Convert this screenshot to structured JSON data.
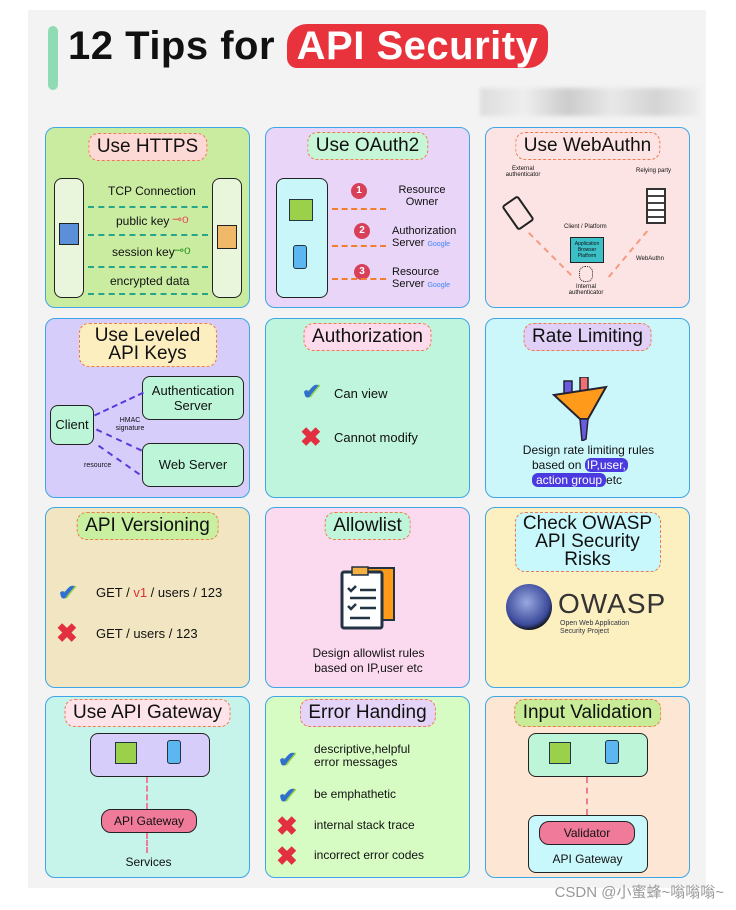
{
  "header": {
    "title_plain": "12 Tips for",
    "title_highlight": "API Security"
  },
  "panels": {
    "https": {
      "title": "Use HTTPS",
      "rows": [
        "TCP Connection",
        "public key",
        "session key",
        "encrypted data"
      ]
    },
    "oauth2": {
      "title": "Use OAuth2",
      "steps": [
        {
          "n": "1",
          "label": "Resource Owner"
        },
        {
          "n": "2",
          "label": "Authorization Server",
          "brand": "Google"
        },
        {
          "n": "3",
          "label": "Resource Server",
          "brand": "Google"
        }
      ]
    },
    "webauthn": {
      "title": "Use WebAuthn",
      "external": "External authenticator",
      "relying": "Relying party",
      "client": "Client / Platform",
      "app": "Application Browser Platform",
      "webauthn": "WebAuthn",
      "internal": "Internal authenticator"
    },
    "leveled": {
      "title": "Use Leveled API Keys",
      "client": "Client",
      "auth_server": "Authentication Server",
      "web_server": "Web Server",
      "hmac": "HMAC signature",
      "resource": "resource"
    },
    "authorization": {
      "title": "Authorization",
      "allowed": "Can view",
      "denied": "Cannot modify"
    },
    "rate": {
      "title": "Rate Limiting",
      "line1": "Design rate limiting rules",
      "line2_pre": "based on",
      "hl1": "IP,user,",
      "hl2": "action group",
      "line3_post": "etc"
    },
    "versioning": {
      "title": "API Versioning",
      "good_pre": "GET / ",
      "good_ver": "v1",
      "good_post": " / users / 123",
      "bad": "GET / users / 123"
    },
    "allowlist": {
      "title": "Allowlist",
      "desc1": "Design allowlist rules",
      "desc2": "based on IP,user etc"
    },
    "owasp": {
      "title": "Check OWASP API Security Risks",
      "logo": "OWASP",
      "sub1": "Open Web Application",
      "sub2": "Security Project"
    },
    "gateway": {
      "title": "Use API Gateway",
      "gateway": "API Gateway",
      "services": "Services"
    },
    "errors": {
      "title": "Error Handing",
      "dos": [
        "descriptive,helpful error messages",
        "be emphathetic"
      ],
      "donts": [
        "internal stack trace",
        "incorrect error codes"
      ]
    },
    "input": {
      "title": "Input Validation",
      "validator": "Validator",
      "gateway": "API Gateway"
    }
  },
  "watermark": "CSDN @小蜜蜂~嗡嗡嗡~",
  "colors": {
    "accent": "#e8323c",
    "border": "#3ea6e6",
    "dash": "#f07a4a"
  }
}
